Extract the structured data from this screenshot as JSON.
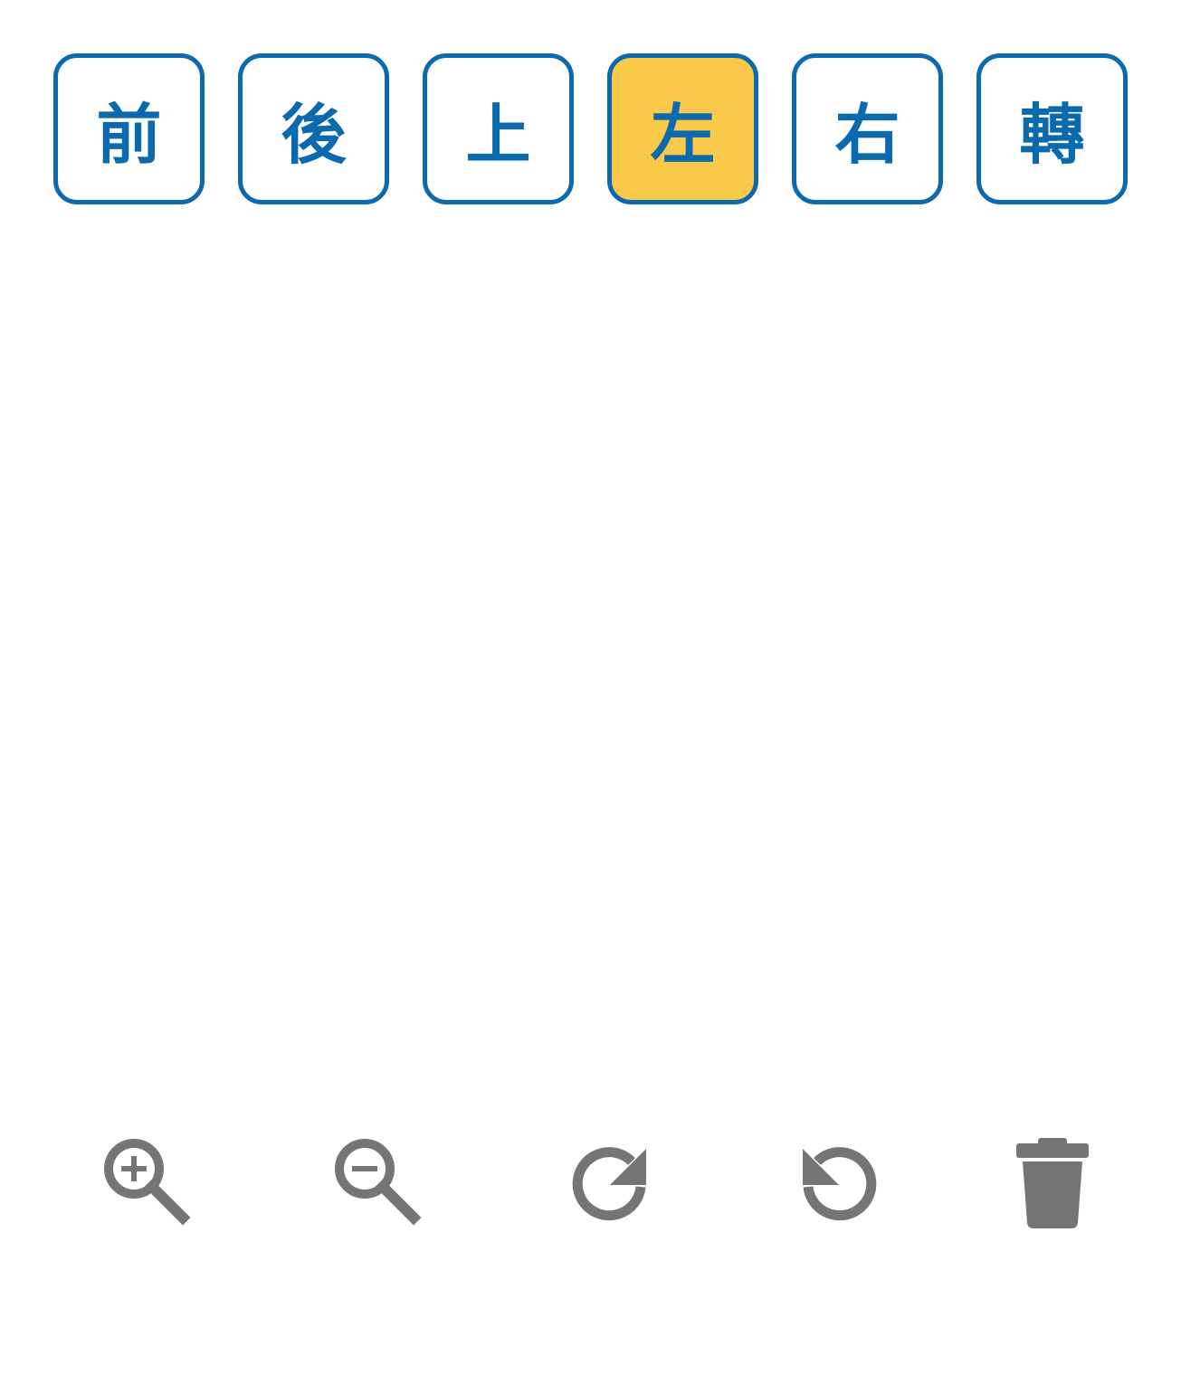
{
  "view_buttons": [
    {
      "label": "前",
      "icon": "front-view",
      "active": false
    },
    {
      "label": "後",
      "icon": "back-view",
      "active": false
    },
    {
      "label": "上",
      "icon": "top-view",
      "active": false
    },
    {
      "label": "左",
      "icon": "left-view",
      "active": true
    },
    {
      "label": "右",
      "icon": "right-view",
      "active": false
    },
    {
      "label": "轉",
      "icon": "rotate-view",
      "active": false
    }
  ],
  "tools": [
    {
      "name": "zoom-in",
      "icon": "zoom-in-icon"
    },
    {
      "name": "zoom-out",
      "icon": "zoom-out-icon"
    },
    {
      "name": "rotate-clockwise",
      "icon": "rotate-clockwise-icon"
    },
    {
      "name": "rotate-counterclockwise",
      "icon": "rotate-counterclockwise-icon"
    },
    {
      "name": "delete",
      "icon": "trash-icon"
    }
  ],
  "colors": {
    "accent_blue": "#0b6aad",
    "active_yellow": "#fac94a",
    "icon_gray": "#757575",
    "background": "#ffffff"
  }
}
